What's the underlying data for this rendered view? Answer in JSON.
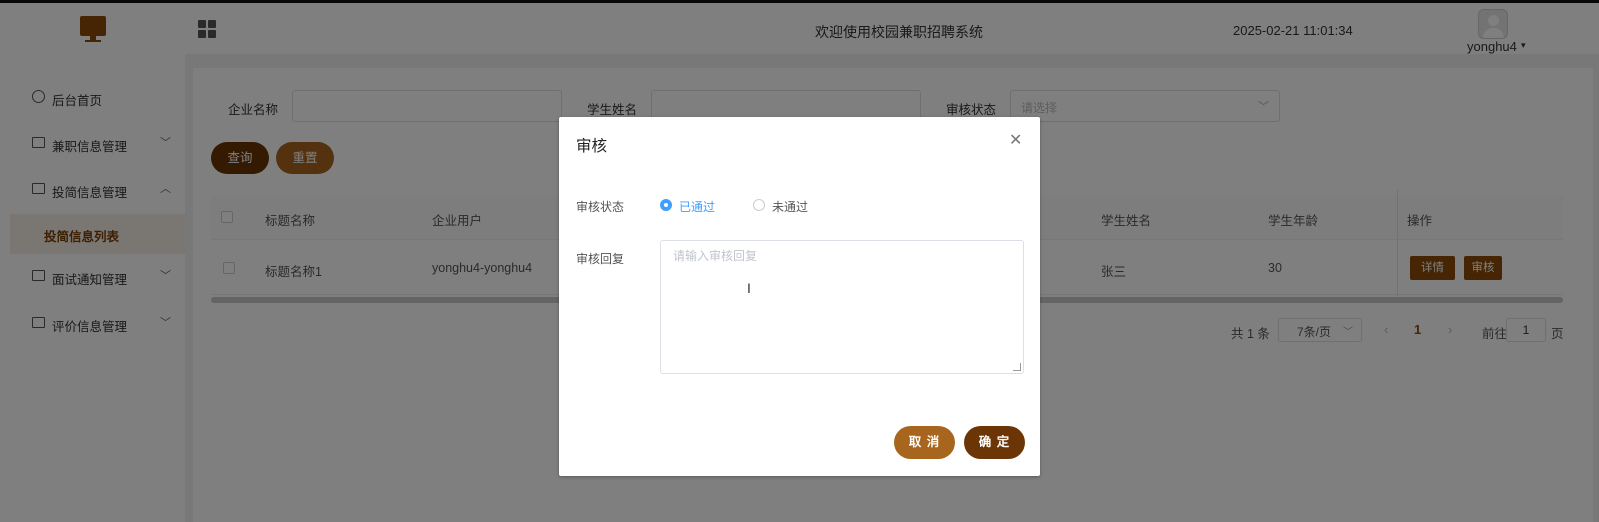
{
  "header": {
    "title": "欢迎使用校园兼职招聘系统",
    "datetime": "2025-02-21 11:01:34",
    "username": "yonghu4"
  },
  "sidebar": {
    "items": [
      {
        "label": "后台首页",
        "icon": "home-icon"
      },
      {
        "label": "兼职信息管理",
        "icon": "list-icon",
        "arrow": "﹀"
      },
      {
        "label": "投简信息管理",
        "icon": "chart-icon",
        "arrow": "︿"
      },
      {
        "label": "面试通知管理",
        "icon": "list-icon",
        "arrow": "﹀"
      },
      {
        "label": "评价信息管理",
        "icon": "list-icon",
        "arrow": "﹀"
      }
    ],
    "active_sub": "投简信息列表"
  },
  "filters": {
    "company_label": "企业名称",
    "company_value": "",
    "student_label": "学生姓名",
    "student_value": "",
    "status_label": "审核状态",
    "status_placeholder": "请选择",
    "query_btn": "查询",
    "reset_btn": "重置"
  },
  "table": {
    "headers": [
      "标题名称",
      "企业用户",
      "学生姓名",
      "学生年龄",
      "操作"
    ],
    "rows": [
      {
        "title": "标题名称1",
        "company_user": "yonghu4-yonghu4",
        "student_name": "张三",
        "student_age": "30",
        "detail_btn": "详情",
        "review_btn": "审核"
      }
    ]
  },
  "pagination": {
    "total": "共 1 条",
    "page_size": "7条/页",
    "current": "1",
    "goto_label": "前往",
    "goto_value": "1",
    "page_suffix": "页"
  },
  "dialog": {
    "title": "审核",
    "status_label": "审核状态",
    "options": [
      "已通过",
      "未通过"
    ],
    "selected": "已通过",
    "reply_label": "审核回复",
    "reply_placeholder": "请输入审核回复",
    "cancel_btn": "取 消",
    "confirm_btn": "确 定"
  },
  "colors": {
    "brand_dark": "#6b3505",
    "brand_mid": "#a8651e",
    "radio_active": "#409eff"
  }
}
